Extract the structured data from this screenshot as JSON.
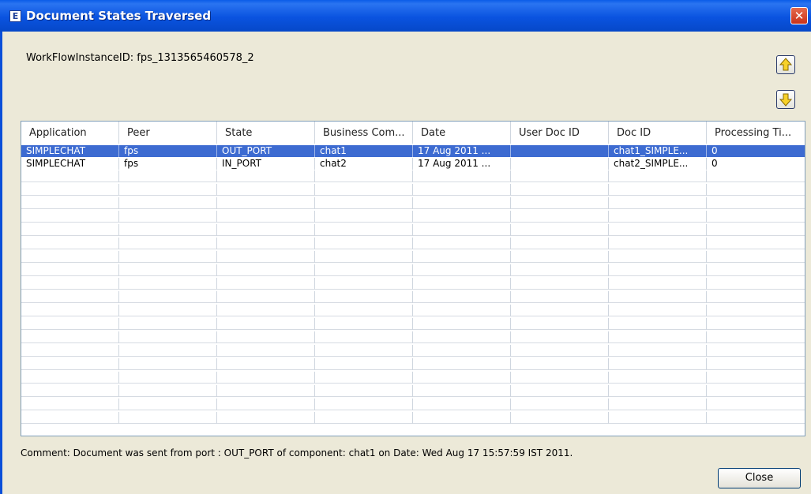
{
  "window": {
    "title": "Document States Traversed",
    "icon_letter": "E",
    "close_glyph": "✕"
  },
  "workflow": {
    "label": "WorkFlowInstanceID: fps_1313565460578_2"
  },
  "buttons": {
    "move_up_icon": "up-arrow-icon",
    "move_down_icon": "down-arrow-icon",
    "close_label": "Close"
  },
  "table": {
    "columns": [
      "Application",
      "Peer",
      "State",
      "Business Com...",
      "Date",
      "User Doc ID",
      "Doc ID",
      "Processing Ti..."
    ],
    "rows": [
      {
        "application": "SIMPLECHAT",
        "peer": "fps",
        "state": "OUT_PORT",
        "business_component": "chat1",
        "date": "17 Aug 2011 ...",
        "user_doc_id": "",
        "doc_id": "chat1_SIMPLE...",
        "processing_time": "0",
        "selected": true
      },
      {
        "application": "SIMPLECHAT",
        "peer": "fps",
        "state": "IN_PORT",
        "business_component": "chat2",
        "date": "17 Aug 2011 ...",
        "user_doc_id": "",
        "doc_id": "chat2_SIMPLE...",
        "processing_time": "0",
        "selected": false
      }
    ]
  },
  "comment": "Comment: Document was sent from port : OUT_PORT of component: chat1 on Date: Wed Aug 17 15:57:59 IST 2011.",
  "colors": {
    "title_bar": "#0a53e0",
    "selection": "#3d6bd1",
    "dialog_bg": "#ece9d8"
  }
}
